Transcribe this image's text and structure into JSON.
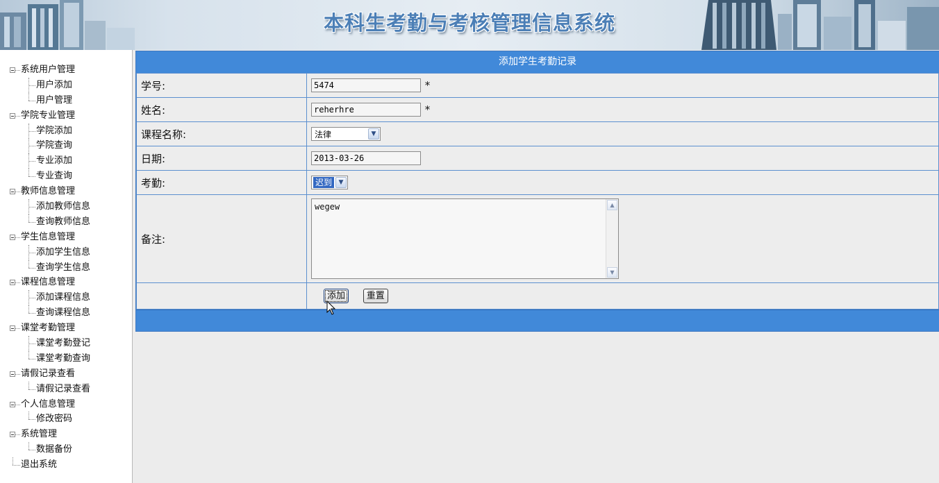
{
  "banner": {
    "title": "本科生考勤与考核管理信息系统"
  },
  "sidebar": {
    "groups": [
      {
        "label": "系统用户管理",
        "items": [
          "用户添加",
          "用户管理"
        ]
      },
      {
        "label": "学院专业管理",
        "items": [
          "学院添加",
          "学院查询",
          "专业添加",
          "专业查询"
        ]
      },
      {
        "label": "教师信息管理",
        "items": [
          "添加教师信息",
          "查询教师信息"
        ]
      },
      {
        "label": "学生信息管理",
        "items": [
          "添加学生信息",
          "查询学生信息"
        ]
      },
      {
        "label": "课程信息管理",
        "items": [
          "添加课程信息",
          "查询课程信息"
        ]
      },
      {
        "label": "课堂考勤管理",
        "items": [
          "课堂考勤登记",
          "课堂考勤查询"
        ]
      },
      {
        "label": "请假记录查看",
        "items": [
          "请假记录查看"
        ]
      },
      {
        "label": "个人信息管理",
        "items": [
          "修改密码"
        ]
      },
      {
        "label": "系统管理",
        "items": [
          "数据备份"
        ]
      }
    ],
    "logout": "退出系统"
  },
  "form": {
    "title": "添加学生考勤记录",
    "student_id": {
      "label": "学号:",
      "value": "5474",
      "required_mark": "*"
    },
    "name": {
      "label": "姓名:",
      "value": "reherhre",
      "required_mark": "*"
    },
    "course": {
      "label": "课程名称:",
      "selected": "法律"
    },
    "date": {
      "label": "日期:",
      "value": "2013-03-26"
    },
    "attendance": {
      "label": "考勤:",
      "selected": "迟到"
    },
    "remarks": {
      "label": "备注:",
      "value": "wegew"
    },
    "add_button": "添加",
    "reset_button": "重置"
  },
  "colors": {
    "header_blue": "#4189d9",
    "border_blue": "#5b8fcf",
    "title_blue": "#4c7fb6"
  }
}
